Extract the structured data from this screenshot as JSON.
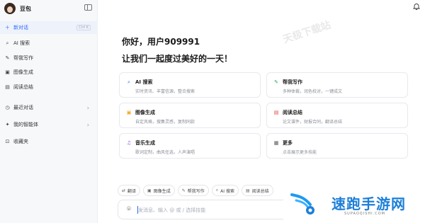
{
  "app": {
    "name": "豆包"
  },
  "sidebar": {
    "new_chat": {
      "label": "新对话",
      "shortcut": "Ctrl K"
    },
    "items": [
      {
        "label": "AI 搜索",
        "icon": "search-icon"
      },
      {
        "label": "帮我写作",
        "icon": "pen-icon"
      },
      {
        "label": "图像生成",
        "icon": "image-icon"
      },
      {
        "label": "阅读总结",
        "icon": "book-icon"
      }
    ],
    "recent": {
      "label": "最近对话"
    },
    "agents": {
      "label": "我的智能体"
    },
    "favorites": {
      "label": "收藏夹"
    }
  },
  "main": {
    "watermark": "天极下载站",
    "greeting_line1": "你好，用户909991",
    "greeting_line2": "让我们一起度过美好的一天！",
    "cards": [
      {
        "title": "AI 搜索",
        "desc": "实时资讯、丰富信源，整合搜索",
        "icon": "search-icon",
        "color": "#2b6cf5"
      },
      {
        "title": "帮我写作",
        "desc": "多种体裁，润色校对，一键成文",
        "icon": "pen-icon",
        "color": "#2ba36a"
      },
      {
        "title": "图像生成",
        "desc": "自定风格，搜集灵感，复制同款",
        "icon": "image-icon",
        "color": "#f5a623"
      },
      {
        "title": "阅读总结",
        "desc": "论文课件，财报合同，翻译总结",
        "icon": "book-icon",
        "color": "#e0433c"
      },
      {
        "title": "音乐生成",
        "desc": "歌词定制，曲风任选，人声演唱",
        "icon": "music-icon",
        "color": "#8a4be8"
      },
      {
        "title": "更多",
        "desc": "点击展示更多技能",
        "icon": "grid-icon",
        "color": "#555555"
      }
    ],
    "chips": [
      {
        "label": "翻译",
        "icon": "translate-icon"
      },
      {
        "label": "图像生成",
        "icon": "image-icon"
      },
      {
        "label": "帮我写作",
        "icon": "pen-icon"
      },
      {
        "label": "AI 搜索",
        "icon": "search-icon"
      },
      {
        "label": "阅读总结",
        "icon": "book-icon"
      }
    ],
    "input": {
      "placeholder": "发消息、输入 @ 或 / 选择技能"
    }
  },
  "promo": {
    "title": "速跑手游网",
    "subtitle": "SUPAOQISHI.COM"
  }
}
